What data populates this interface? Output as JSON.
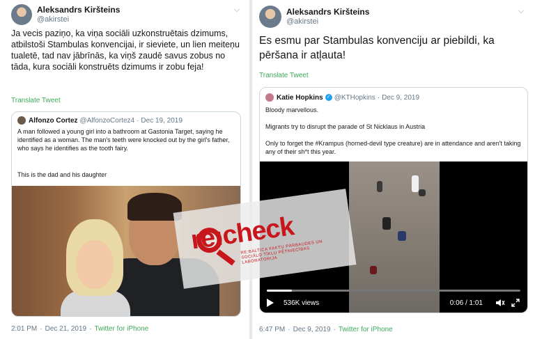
{
  "left_tweet": {
    "author_name": "Aleksandrs Kiršteins",
    "author_handle": "@akirstei",
    "text": "Ja vecis paziņo, ka viņa sociāli uzkonstruētais dzimums, atbilstoši Stambulas konvencijai, ir sieviete, un lien meiteņu tualetē, tad nav jābrīnās, ka viņš zaudē savus zobus no tāda, kura sociāli konstruēts dzimums ir zobu feja!",
    "translate_label": "Translate Tweet",
    "quote": {
      "author_name": "Alfonzo Cortez",
      "author_handle": "@AlfonzoCortez4",
      "date": "Dec 19, 2019",
      "text": "A man followed a young girl into a bathroom at Gastonia Target, saying he identified as a woman. The man's teeth were knocked out by the girl's father, who says he identifies as the tooth fairy.",
      "text2": "This is the dad and his daughter"
    },
    "footer": {
      "time": "2:01 PM",
      "date": "Dec 21, 2019",
      "source": "Twitter for iPhone"
    }
  },
  "right_tweet": {
    "author_name": "Aleksandrs Kiršteins",
    "author_handle": "@akirstei",
    "text": "Es esmu par Stambulas konvenciju ar piebildi, ka pēršana ir atļauta!",
    "translate_label": "Translate Tweet",
    "quote": {
      "author_name": "Katie Hopkins",
      "author_handle": "@KTHopkins",
      "date": "Dec 9, 2019",
      "line1": "Bloody marvellous.",
      "line2": "Migrants try to disrupt the parade of St Nicklaus in Austria",
      "line3": "Only to forget the #Krampus (horned-devil type creature) are in attendance and aren't taking any of their sh*t this year."
    },
    "video": {
      "views": "536K views",
      "time": "0:06 / 1:01",
      "progress": 0.1
    },
    "footer": {
      "time": "6:47 PM",
      "date": "Dec 9, 2019",
      "source": "Twitter for iPhone"
    }
  },
  "watermark": {
    "logo": "re:check",
    "subtitle": "RE:BALTICA FAKTU PĀRBAUDES UN SOCIĀLO TĪKLU PĒTNIECĪBAS LABORATORIJA"
  },
  "colors": {
    "link_green": "#3eaa5b",
    "recheck_red": "#c8161d",
    "verified_blue": "#1da1f2"
  }
}
